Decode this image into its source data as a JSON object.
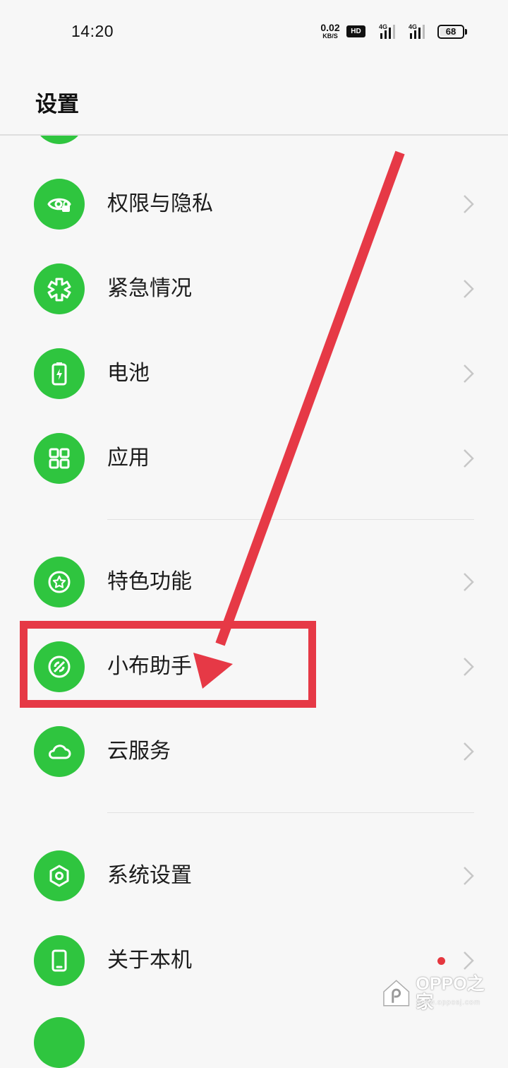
{
  "status_bar": {
    "time": "14:20",
    "net_speed_value": "0.02",
    "net_speed_unit": "KB/S",
    "hd_badge": "HD",
    "sim1_label": "4G",
    "sim2_label": "4G",
    "battery_level": "68"
  },
  "header": {
    "title": "设置"
  },
  "settings": {
    "items": [
      {
        "label": "权限与隐私",
        "icon": "privacy-eye-lock-icon"
      },
      {
        "label": "紧急情况",
        "icon": "emergency-asterisk-icon"
      },
      {
        "label": "电池",
        "icon": "battery-icon"
      },
      {
        "label": "应用",
        "icon": "apps-grid-icon"
      },
      {
        "label": "特色功能",
        "icon": "special-features-star-icon"
      },
      {
        "label": "小布助手",
        "icon": "breeno-assistant-icon"
      },
      {
        "label": "云服务",
        "icon": "cloud-icon"
      },
      {
        "label": "系统设置",
        "icon": "hexagon-settings-icon"
      },
      {
        "label": "关于本机",
        "icon": "phone-icon"
      }
    ]
  },
  "watermark": {
    "text": "OPPO之家",
    "url": "www.opposj.com"
  },
  "colors": {
    "accent_green": "#2fc53f",
    "annotation_red": "#e63946",
    "badge_red": "#e5373f"
  }
}
